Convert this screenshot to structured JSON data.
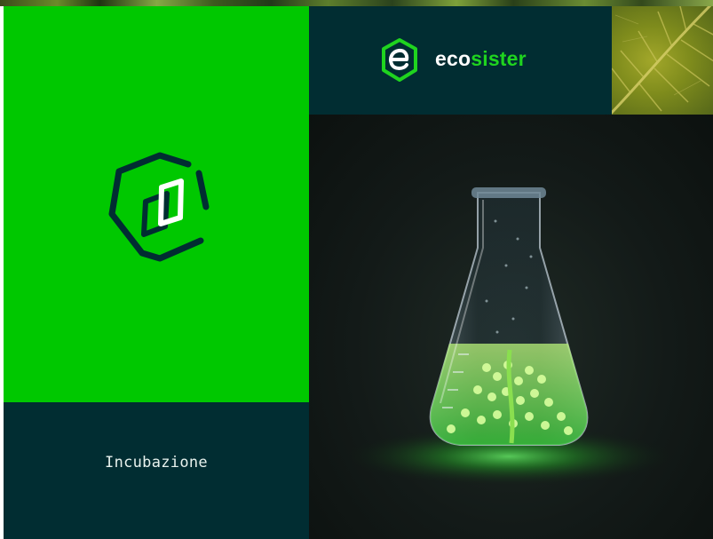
{
  "brand": {
    "name_part1": "eco",
    "name_part2": "sister",
    "icon": "ecosister-hexagon-e-icon",
    "colors": {
      "green": "#00c800",
      "dark_teal": "#012d32",
      "accent_green": "#1fd41f"
    }
  },
  "left_panel": {
    "icon": "ecosister-hexagon-mark-icon"
  },
  "caption_panel": {
    "label": "Incubazione"
  },
  "images": {
    "top_strip": "foliage-strip-image",
    "leaf": "green-leaf-image",
    "photo": "erlenmeyer-flask-with-algae-image"
  }
}
